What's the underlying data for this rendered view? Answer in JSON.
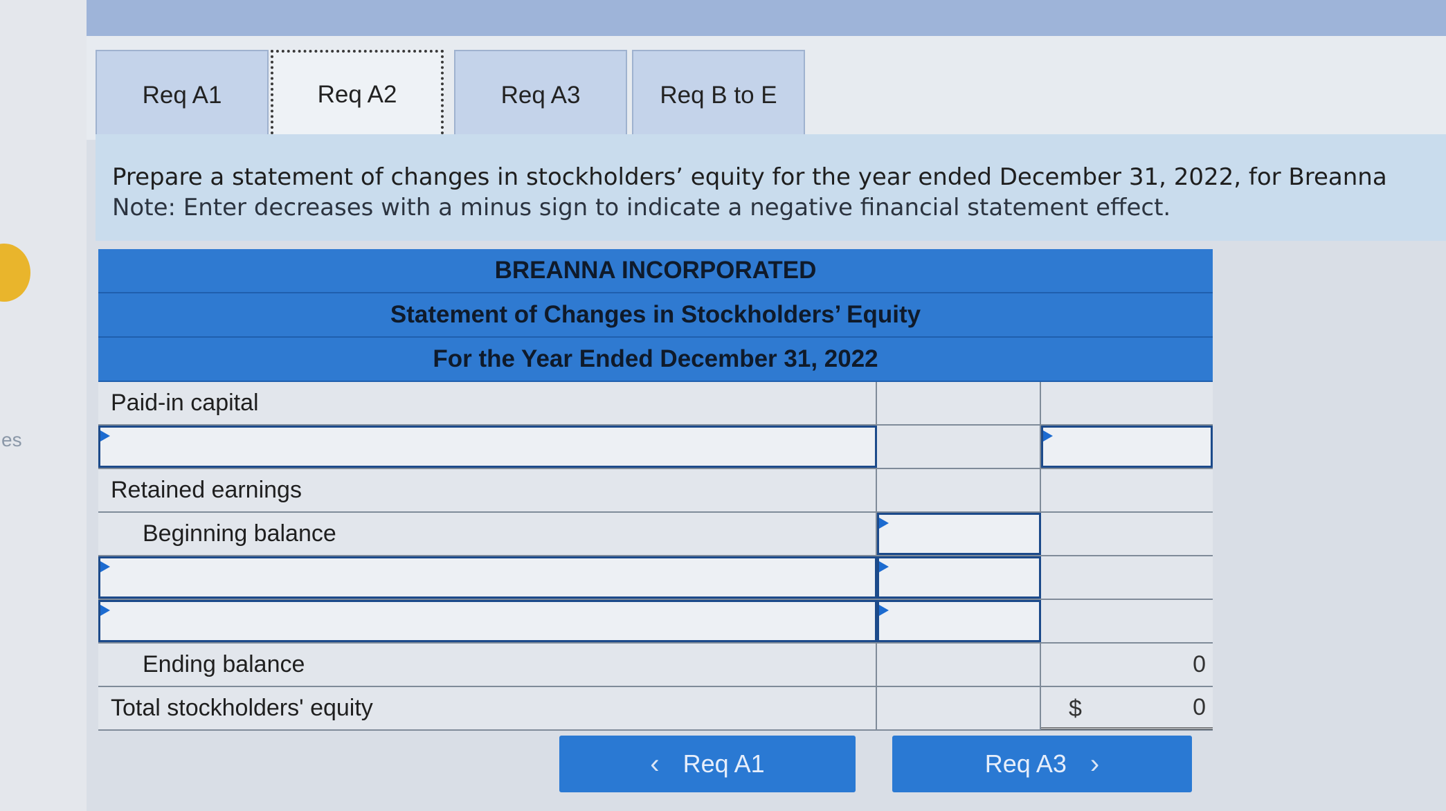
{
  "side": {
    "text": "es"
  },
  "tabs": [
    {
      "label": "Req A1"
    },
    {
      "label": "Req A2"
    },
    {
      "label": "Req A3"
    },
    {
      "label": "Req B to E"
    }
  ],
  "instruction": {
    "line1": "Prepare a statement of changes in stockholders’ equity for the year ended December 31, 2022, for Breanna",
    "line2": "Note: Enter decreases with a minus sign to indicate a negative financial statement effect."
  },
  "statement": {
    "company": "BREANNA INCORPORATED",
    "title": "Statement of Changes in Stockholders’ Equity",
    "period": "For the Year Ended December 31, 2022",
    "rows": {
      "paid_in_capital": "Paid-in capital",
      "retained_earnings": "Retained earnings",
      "beginning_balance": "Beginning balance",
      "ending_balance": "Ending balance",
      "ending_balance_value": "0",
      "total_equity": "Total stockholders' equity",
      "total_currency": "$",
      "total_value": "0"
    }
  },
  "nav": {
    "prev_label": "Req A1",
    "next_label": "Req A3",
    "prev_chevron": "‹",
    "next_chevron": "›"
  }
}
